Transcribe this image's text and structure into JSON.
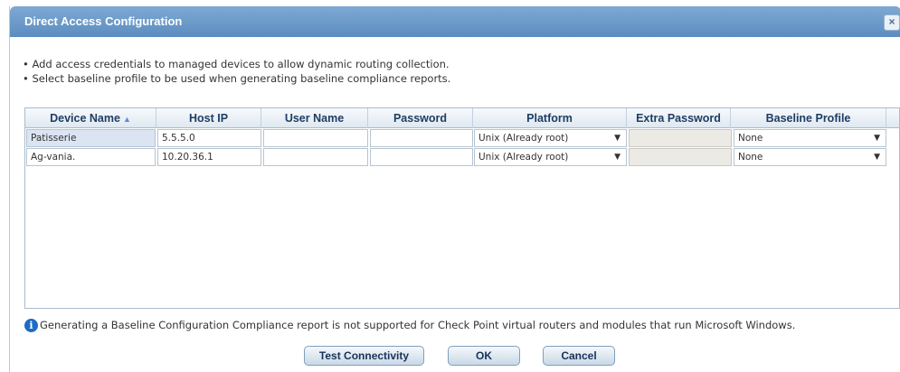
{
  "dialog": {
    "title": "Direct Access Configuration",
    "close_label": "×"
  },
  "instructions": [
    "• Add access credentials to managed devices to allow dynamic routing collection.",
    "• Select baseline profile to be used when generating baseline compliance reports."
  ],
  "table": {
    "columns": [
      "Device Name",
      "Host IP",
      "User Name",
      "Password",
      "Platform",
      "Extra Password",
      "Baseline Profile"
    ],
    "sort_indicator": "▲▼",
    "rows": [
      {
        "device_name": "Patisserie",
        "host_ip": "5.5.5.0",
        "user_name": "",
        "password": "",
        "platform": "Unix (Already root)",
        "extra_password": "",
        "baseline_profile": "None"
      },
      {
        "device_name": "Ag-vania.",
        "host_ip": "10.20.36.1",
        "user_name": "",
        "password": "",
        "platform": "Unix (Already root)",
        "extra_password": "",
        "baseline_profile": "None"
      }
    ]
  },
  "note": {
    "icon": "info-icon",
    "text": "Generating a Baseline Configuration Compliance report is not supported for Check Point virtual routers and modules that run Microsoft Windows."
  },
  "buttons": {
    "test_connectivity": "Test Connectivity",
    "ok": "OK",
    "cancel": "Cancel"
  },
  "colors": {
    "titlebar": "#6b9bcb",
    "header_text": "#1f3d63",
    "info_icon": "#1d6bc4"
  }
}
